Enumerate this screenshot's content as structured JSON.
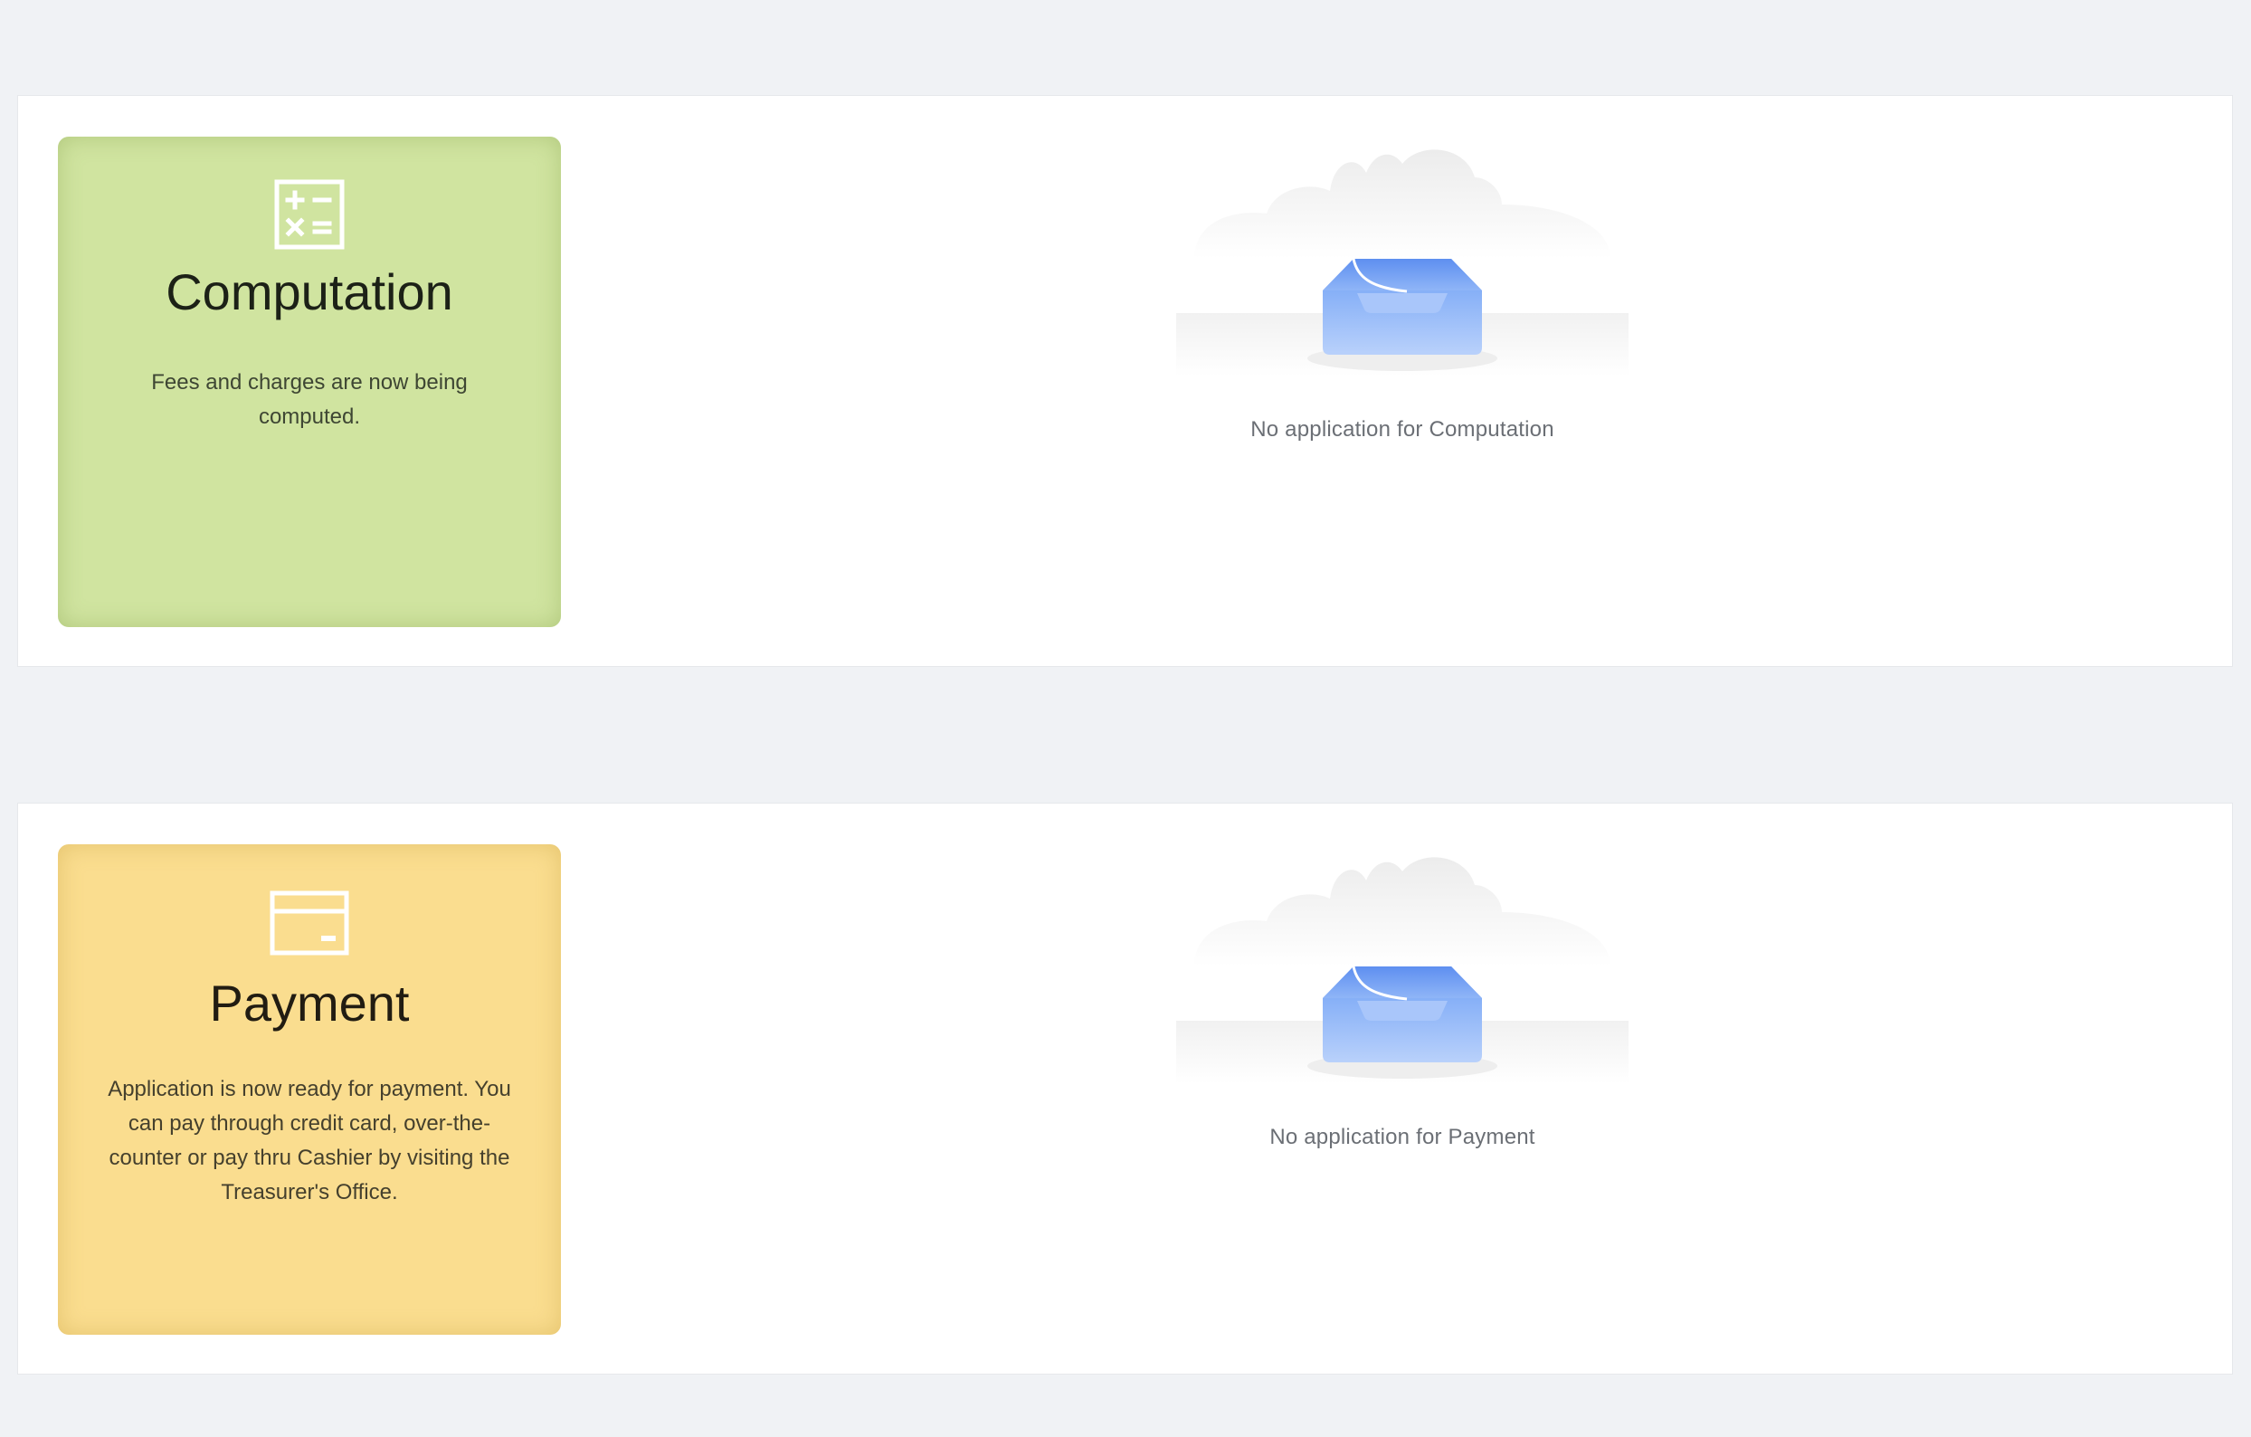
{
  "sections": [
    {
      "card": {
        "title": "Computation",
        "description": "Fees and charges are now being computed.",
        "icon": "calculator-icon",
        "color": "#d0e4a0"
      },
      "empty_state": {
        "message": "No application for Computation",
        "icon": "empty-inbox-icon"
      }
    },
    {
      "card": {
        "title": "Payment",
        "description": "Application is now ready for payment. You can pay through credit card, over-the-counter or pay thru Cashier by visiting the Treasurer's Office.",
        "icon": "credit-card-icon",
        "color": "#fadd8f"
      },
      "empty_state": {
        "message": "No application for Payment",
        "icon": "empty-inbox-icon"
      }
    }
  ],
  "colors": {
    "page_background": "#f0f2f5",
    "panel_background": "#ffffff",
    "inbox_blue": "#7aa8f6"
  }
}
